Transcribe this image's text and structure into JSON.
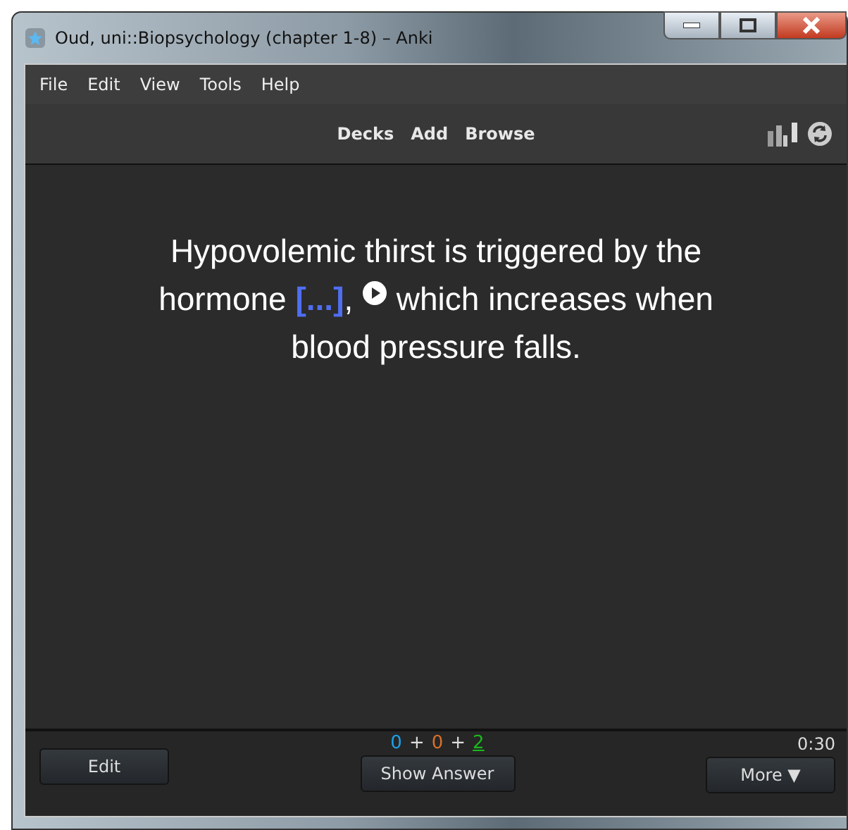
{
  "window": {
    "title": "Oud, uni::Biopsychology (chapter 1-8) – Anki"
  },
  "menu": [
    "File",
    "Edit",
    "View",
    "Tools",
    "Help"
  ],
  "toolbar": [
    "Decks",
    "Add",
    "Browse"
  ],
  "card": {
    "line1": "Hypovolemic thirst is triggered by the",
    "before": "hormone **[...]**,",
    "after": "which increases when",
    "line3": "blood pressure falls."
  },
  "bottom": {
    "edit": "Edit",
    "show_answer": "Show Answer",
    "more": "More ▼",
    "timer": "0:30",
    "counts": [
      {
        "text": "0",
        "color": "#1ea0e8",
        "selected": false
      },
      {
        "text": "0",
        "color": "#d8702a",
        "selected": false
      },
      {
        "text": "2",
        "color": "#1cb81c",
        "selected": true
      }
    ],
    "separators": [
      "+",
      "+"
    ]
  }
}
